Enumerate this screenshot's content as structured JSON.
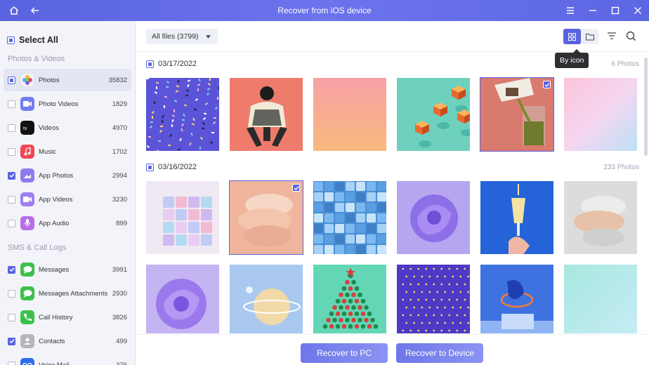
{
  "window": {
    "title": "Recover from iOS device",
    "icons": [
      "home-icon",
      "back-arrow-icon",
      "menu-icon",
      "minimize-icon",
      "maximize-icon",
      "close-icon"
    ]
  },
  "sidebar": {
    "select_all": "Select All",
    "sections": [
      {
        "label": "Photos & Videos",
        "items": [
          {
            "label": "Photos",
            "count": "35832",
            "state": "partial",
            "icon": "photos-icon",
            "color": "#f3f3f3",
            "active": true
          },
          {
            "label": "Photo Videos",
            "count": "1829",
            "state": "off",
            "icon": "photo-videos-icon",
            "color": "#6f7df1"
          },
          {
            "label": "Videos",
            "count": "4970",
            "state": "off",
            "icon": "apple-tv-icon",
            "color": "#111111"
          },
          {
            "label": "Music",
            "count": "1702",
            "state": "off",
            "icon": "music-icon",
            "color": "#f4454f"
          },
          {
            "label": "App Photos",
            "count": "2994",
            "state": "on",
            "icon": "app-photos-icon",
            "color": "#8d7bf0"
          },
          {
            "label": "App Videos",
            "count": "3230",
            "state": "off",
            "icon": "app-videos-icon",
            "color": "#9f7ef2"
          },
          {
            "label": "App Audio",
            "count": "899",
            "state": "off",
            "icon": "app-audio-icon",
            "color": "#b96ee8"
          }
        ]
      },
      {
        "label": "SMS & Call Logs",
        "items": [
          {
            "label": "Messages",
            "count": "3991",
            "state": "on",
            "icon": "messages-icon",
            "color": "#3cc04c"
          },
          {
            "label": "Messages Attachments",
            "count": "2930",
            "state": "off",
            "icon": "messages-attachments-icon",
            "color": "#3cc04c"
          },
          {
            "label": "Call History",
            "count": "3826",
            "state": "off",
            "icon": "phone-icon",
            "color": "#3cc04c"
          },
          {
            "label": "Contacts",
            "count": "499",
            "state": "on",
            "icon": "contacts-icon",
            "color": "#b5b5bb"
          },
          {
            "label": "Voice Mail",
            "count": "376",
            "state": "off",
            "icon": "voicemail-icon",
            "color": "#2d6ee8"
          }
        ]
      }
    ]
  },
  "toolbar": {
    "filter_label": "All files (3799)",
    "tooltip": "By icon",
    "icons": [
      "grid-view-icon",
      "folder-view-icon",
      "filter-icon",
      "search-icon"
    ]
  },
  "groups": [
    {
      "date": "03/17/2022",
      "count": "6 Photos",
      "checked": true
    },
    {
      "date": "03/16/2022",
      "count": "233 Photos",
      "checked": true
    }
  ],
  "thumbnails": [
    {
      "name": "confetti-pattern",
      "selected": false
    },
    {
      "name": "fashion-figure",
      "selected": false
    },
    {
      "name": "peach-gradient",
      "selected": false
    },
    {
      "name": "orange-cubes",
      "selected": false
    },
    {
      "name": "pouring-drink",
      "selected": true
    },
    {
      "name": "pastel-gradient",
      "selected": false
    },
    {
      "name": "glass-cubes",
      "selected": false
    },
    {
      "name": "stacked-discs-peach",
      "selected": true
    },
    {
      "name": "blue-blocks",
      "selected": false
    },
    {
      "name": "purple-swirl",
      "selected": false
    },
    {
      "name": "champagne-glass",
      "selected": false
    },
    {
      "name": "stacked-discs-grey",
      "selected": false
    },
    {
      "name": "purple-swirl-2",
      "selected": false
    },
    {
      "name": "planet-ring",
      "selected": false
    },
    {
      "name": "christmas-tree",
      "selected": false
    },
    {
      "name": "dotted-purple",
      "selected": false
    },
    {
      "name": "blue-ring-sculpture",
      "selected": false
    },
    {
      "name": "teal-gradient",
      "selected": false
    }
  ],
  "buttons": {
    "recover_pc": "Recover to PC",
    "recover_device": "Recover to Device"
  }
}
